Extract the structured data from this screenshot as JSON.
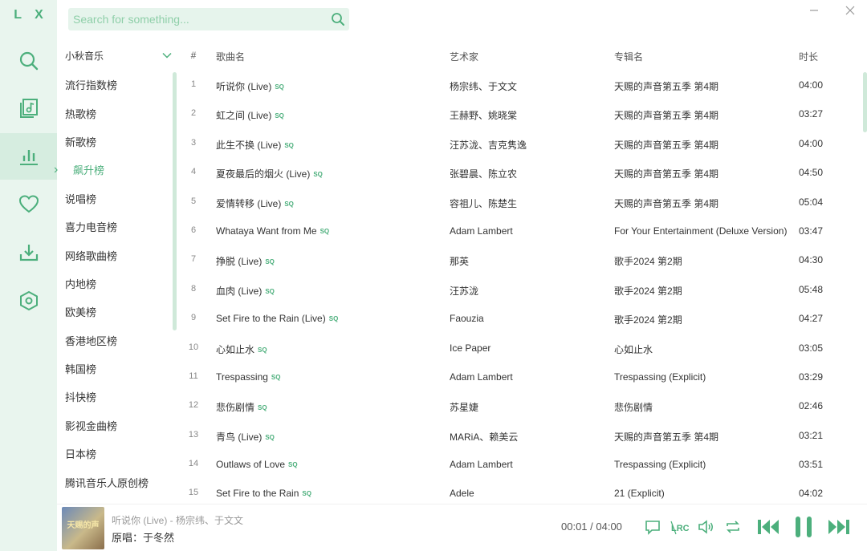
{
  "app": {
    "logo": "L X"
  },
  "search": {
    "placeholder": "Search for something..."
  },
  "source": {
    "name": "小秋音乐"
  },
  "boards": [
    "流行指数榜",
    "热歌榜",
    "新歌榜",
    "飙升榜",
    "说唱榜",
    "喜力电音榜",
    "网络歌曲榜",
    "内地榜",
    "欧美榜",
    "香港地区榜",
    "韩国榜",
    "抖快榜",
    "影视金曲榜",
    "日本榜",
    "腾讯音乐人原创榜"
  ],
  "active_board": "飙升榜",
  "table": {
    "headers": {
      "index": "#",
      "name": "歌曲名",
      "artist": "艺术家",
      "album": "专辑名",
      "duration": "时长"
    },
    "quality_badge": "SQ",
    "rows": [
      {
        "index": "1",
        "name": "听说你 (Live)",
        "artist": "杨宗纬、于文文",
        "album": "天赐的声音第五季 第4期",
        "duration": "04:00"
      },
      {
        "index": "2",
        "name": "虹之间 (Live)",
        "artist": "王赫野、姚晓棠",
        "album": "天赐的声音第五季 第4期",
        "duration": "03:27"
      },
      {
        "index": "3",
        "name": "此生不换 (Live)",
        "artist": "汪苏泷、吉克隽逸",
        "album": "天赐的声音第五季 第4期",
        "duration": "04:00"
      },
      {
        "index": "4",
        "name": "夏夜最后的烟火 (Live)",
        "artist": "张碧晨、陈立农",
        "album": "天赐的声音第五季 第4期",
        "duration": "04:50"
      },
      {
        "index": "5",
        "name": "爱情转移 (Live)",
        "artist": "容祖儿、陈楚生",
        "album": "天赐的声音第五季 第4期",
        "duration": "05:04"
      },
      {
        "index": "6",
        "name": "Whataya Want from Me",
        "artist": "Adam Lambert",
        "album": "For Your Entertainment (Deluxe Version)",
        "duration": "03:47"
      },
      {
        "index": "7",
        "name": "挣脱 (Live)",
        "artist": "那英",
        "album": "歌手2024 第2期",
        "duration": "04:30"
      },
      {
        "index": "8",
        "name": "血肉 (Live)",
        "artist": "汪苏泷",
        "album": "歌手2024 第2期",
        "duration": "05:48"
      },
      {
        "index": "9",
        "name": "Set Fire to the Rain (Live)",
        "artist": "Faouzia",
        "album": "歌手2024 第2期",
        "duration": "04:27"
      },
      {
        "index": "10",
        "name": "心如止水",
        "artist": "Ice Paper",
        "album": "心如止水",
        "duration": "03:05"
      },
      {
        "index": "11",
        "name": "Trespassing",
        "artist": "Adam Lambert",
        "album": "Trespassing (Explicit)",
        "duration": "03:29"
      },
      {
        "index": "12",
        "name": "悲伤剧情",
        "artist": "苏星婕",
        "album": "悲伤剧情",
        "duration": "02:46"
      },
      {
        "index": "13",
        "name": "青鸟 (Live)",
        "artist": "MARiA、赖美云",
        "album": "天赐的声音第五季 第4期",
        "duration": "03:21"
      },
      {
        "index": "14",
        "name": "Outlaws of Love",
        "artist": "Adam Lambert",
        "album": "Trespassing (Explicit)",
        "duration": "03:51"
      },
      {
        "index": "15",
        "name": "Set Fire to the Rain",
        "artist": "Adele",
        "album": "21 (Explicit)",
        "duration": "04:02"
      }
    ]
  },
  "player": {
    "cover_text": "天赐的声",
    "now_playing": "听说你 (Live) - 杨宗纬、于文文",
    "lyric": "原唱：于冬然",
    "time": "00:01 / 04:00",
    "accent": "#4caf7c"
  }
}
